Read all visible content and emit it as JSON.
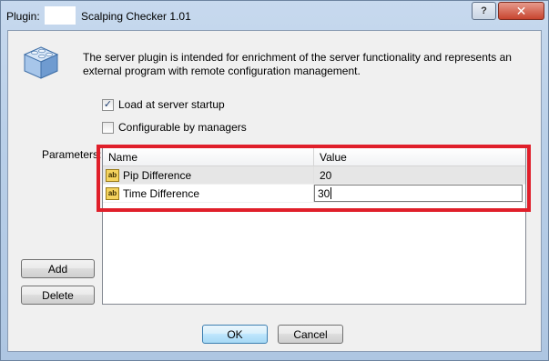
{
  "title": {
    "prefix": "Plugin:",
    "name": "Scalping Checker 1.01"
  },
  "window_buttons": {
    "help": "?",
    "close": "✕"
  },
  "description": "The server plugin is intended for enrichment of the server functionality and represents an external program with remote configuration management.",
  "options": {
    "load_at_startup": {
      "label": "Load at server startup",
      "checked": true
    },
    "configurable_by_managers": {
      "label": "Configurable by managers",
      "checked": false
    }
  },
  "parameters": {
    "label": "Parameters:",
    "columns": [
      "Name",
      "Value"
    ],
    "rows": [
      {
        "name": "Pip Difference",
        "value": "20",
        "icon": "ab-icon"
      },
      {
        "name": "Time Difference",
        "value": "30",
        "icon": "ab-icon"
      }
    ]
  },
  "buttons": {
    "add": "Add",
    "delete": "Delete",
    "ok": "OK",
    "cancel": "Cancel"
  },
  "icon_text": "ab",
  "colors": {
    "highlight": "#e01f2a",
    "plugin_icon": "#4f86c6"
  }
}
